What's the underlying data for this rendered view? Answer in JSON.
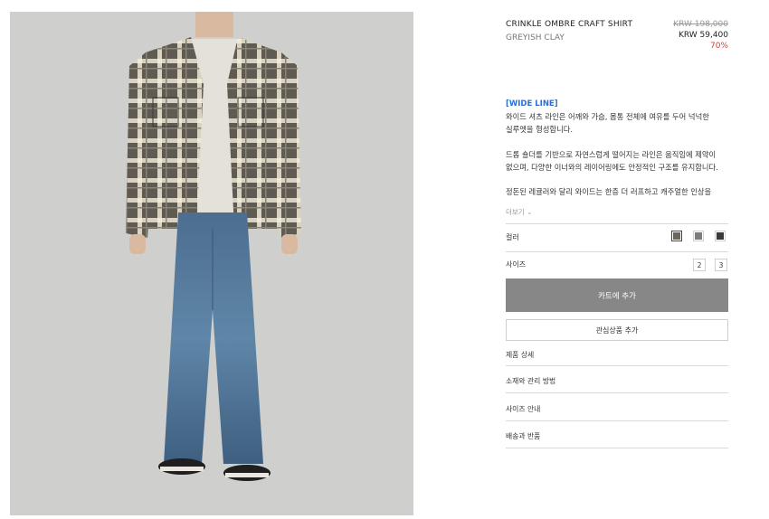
{
  "product": {
    "name": "CRINKLE OMBRE CRAFT SHIRT",
    "color_name": "GREYISH CLAY",
    "original_price": "KRW 198,000",
    "sale_price": "KRW 59,400",
    "discount": "70%"
  },
  "description": {
    "tag": "[WIDE LINE]",
    "paragraph1": [
      "와이드 셔츠 라인은 어깨와 가슴, 몸통 전체에 여유를 두어 넉넉한",
      "실루엣을 형성합니다."
    ],
    "paragraph2": [
      "드롭 숄더를 기반으로 자연스럽게 떨어지는 라인은 움직임에 제약이",
      "없으며, 다양한 이너와의 레이어링에도 안정적인 구조를 유지합니다."
    ],
    "paragraph3": "정돈된 레귤러와 달리 와이드는 한층 더 러프하고 캐주얼한 인상을",
    "more_label": "더보기 ⌄"
  },
  "options": {
    "color_label": "컬러",
    "color_swatches": [
      {
        "name": "greyish-clay",
        "selected": true,
        "color": "#6b655c"
      },
      {
        "name": "grey",
        "selected": false,
        "color": "#7d7d7d"
      },
      {
        "name": "black",
        "selected": false,
        "color": "#3a3a3a"
      }
    ],
    "size_label": "사이즈",
    "sizes": [
      "2",
      "3"
    ]
  },
  "actions": {
    "add_to_cart": "카트에 추가",
    "add_to_wishlist": "관심상품 추가"
  },
  "accordion": [
    "제품 상세",
    "소재와 관리 방법",
    "사이즈 안내",
    "배송과 반품"
  ],
  "colors": {
    "accent_blue": "#2a6fd6",
    "discount_red": "#e03a2e",
    "cart_button": "#878787",
    "photo_bg": "#cfcfcd"
  }
}
